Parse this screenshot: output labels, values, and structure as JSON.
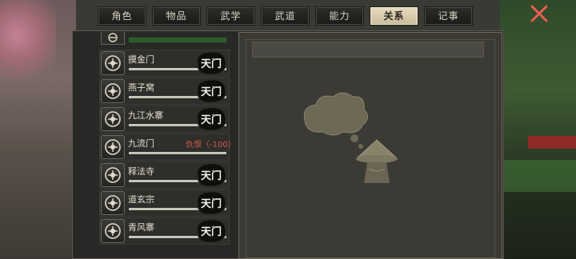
{
  "tabs": [
    {
      "label": "角色",
      "active": false
    },
    {
      "label": "物品",
      "active": false
    },
    {
      "label": "武学",
      "active": false
    },
    {
      "label": "武道",
      "active": false
    },
    {
      "label": "能力",
      "active": false
    },
    {
      "label": "关系",
      "active": true
    },
    {
      "label": "记事",
      "active": false
    }
  ],
  "close_icon": "close-x-icon",
  "sects": [
    {
      "name": "摸金门",
      "status": "",
      "seal": "sealed-gate-icon",
      "bar": 0.0
    },
    {
      "name": "燕子窝",
      "status": "",
      "seal": "sealed-gate-icon",
      "bar": 0.0
    },
    {
      "name": "九江水寨",
      "status": "",
      "seal": "sealed-gate-icon",
      "bar": 0.0
    },
    {
      "name": "九流门",
      "status": "仇恨（-100）",
      "seal": "",
      "bar": 0.0
    },
    {
      "name": "释法寺",
      "status": "",
      "seal": "sealed-gate-icon",
      "bar": 0.0
    },
    {
      "name": "道玄宗",
      "status": "",
      "seal": "sealed-gate-icon",
      "bar": 0.0
    },
    {
      "name": "青风寨",
      "status": "",
      "seal": "sealed-gate-icon",
      "bar": 0.0
    }
  ],
  "seal_text": "天门",
  "colors": {
    "tab_active_bg": "#d8cdb0",
    "panel_bg": "#282826",
    "status_red": "#d25a4c",
    "bar_green": "#2f5a2e"
  }
}
